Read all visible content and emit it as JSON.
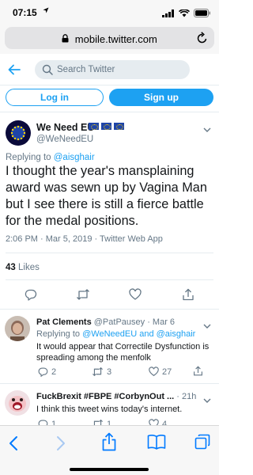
{
  "status_bar": {
    "time": "07:15",
    "location_arrow": "location-arrow-icon"
  },
  "browser": {
    "url": "mobile.twitter.com"
  },
  "twitter_header": {
    "search_placeholder": "Search Twitter"
  },
  "auth": {
    "login_label": "Log in",
    "signup_label": "Sign up"
  },
  "main_tweet": {
    "author_name": "We Need EU",
    "author_handle": "@WeNeedEU",
    "flag_count": 3,
    "replying_prefix": "Replying to",
    "replying_to": "@aisghair",
    "text": "I thought the year's mansplaining award was sewn up by Vagina Man but I see there is still a fierce battle for the medal positions.",
    "timestamp": "2:06 PM · Mar 5, 2019 · Twitter Web App",
    "likes_count": "43",
    "likes_label": "Likes"
  },
  "replies": [
    {
      "author_name": "Pat Clements",
      "author_handle": "@PatPausey",
      "date": "· Mar 6",
      "replying_prefix": "Replying to",
      "replying_to_1": "@WeNeedEU",
      "replying_and": "and",
      "replying_to_2": "@aisghair",
      "text": "It would appear that Correctile Dysfunction is spreading among the menfolk",
      "reply_count": "2",
      "retweet_count": "3",
      "like_count": "27"
    },
    {
      "author_name": "FuckBrexit #FBPE #CorbynOut ...",
      "date": "· 21h",
      "text": "I think this tweet wins today's internet.",
      "reply_count": "1",
      "retweet_count": "1",
      "like_count": "4"
    }
  ],
  "colors": {
    "twitter_blue": "#1da1f2",
    "ios_blue": "#007aff",
    "secondary_text": "#657786",
    "primary_text": "#14171a"
  }
}
